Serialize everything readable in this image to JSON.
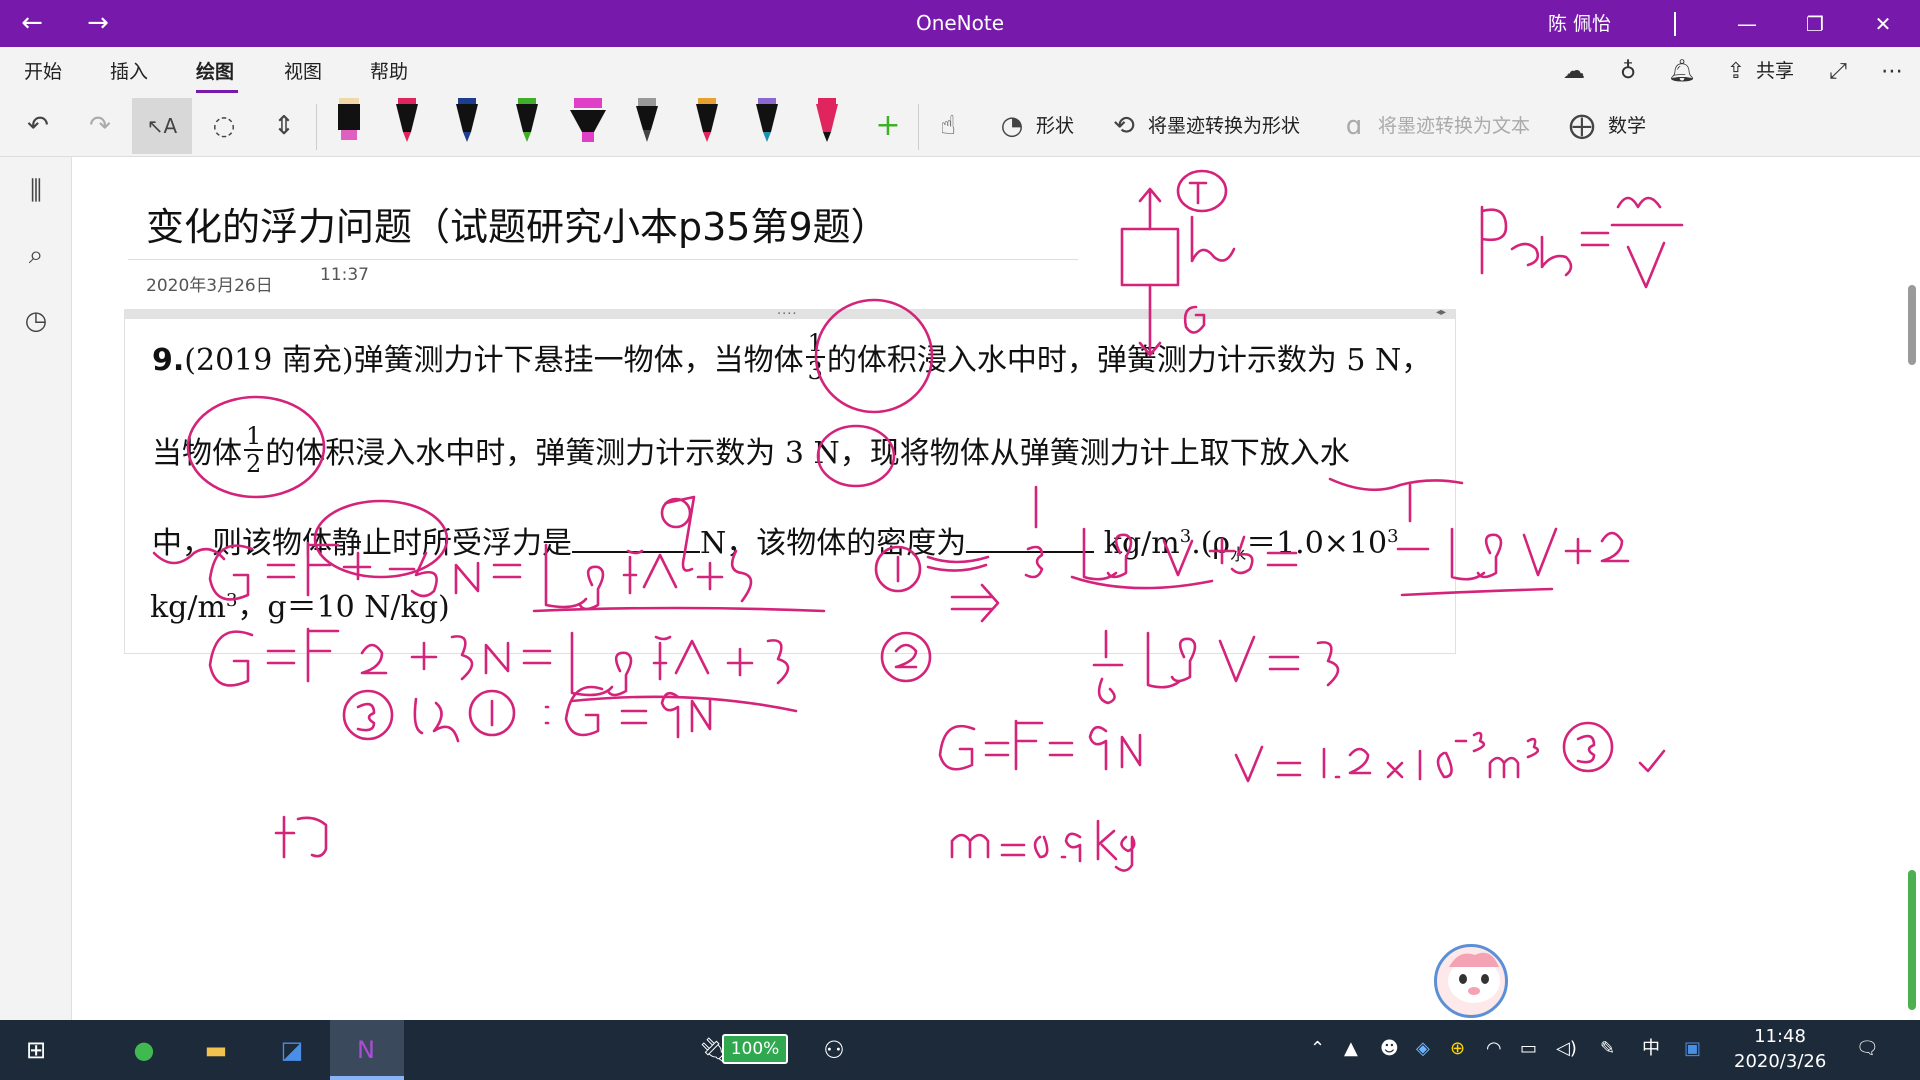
{
  "window": {
    "app_title": "OneNote",
    "user_name": "陈 佩怡",
    "back_icon": "arrow-left-icon",
    "forward_icon": "arrow-right-icon",
    "colors": {
      "titlebar": "#7719aa",
      "ink": "#d4237a"
    }
  },
  "tabs": [
    "开始",
    "插入",
    "绘图",
    "视图",
    "帮助"
  ],
  "active_tab": "绘图",
  "top_actions": {
    "share": "共享"
  },
  "toolbar": {
    "shapes_label": "形状",
    "ink_to_shape_label": "将墨迹转换为形状",
    "ink_to_text_label": "将墨迹转换为文本",
    "math_label": "数学",
    "pens": [
      "#111111",
      "#e0245e",
      "#1d3d8f",
      "#3fae29",
      "#e040c8",
      "#999999",
      "#e0245e",
      "#1d3d8f",
      "#e0245e"
    ]
  },
  "page": {
    "title": "变化的浮力问题（试题研究小本p35第9题）",
    "date": "2020年3月26日",
    "time": "11:37",
    "problem": {
      "number": "9.",
      "line1_a": "(2019 南充)弹簧测力计下悬挂一物体，当物体",
      "frac1_num": "1",
      "frac1_den": "3",
      "line1_b": "的体积浸入水中时，弹簧测力计示数为 5 N，",
      "line2_a": "当物体",
      "frac2_num": "1",
      "frac2_den": "2",
      "line2_b": "的体积浸入水中时，弹簧测力计示数为 3 N，现将物体从弹簧测力计上取下放入水",
      "line3_a": "中，则该物体静止时所受浮力是",
      "line3_b": "N，该物体的密度为",
      "line3_c": " kg/m",
      "line3_d": ".(ρ",
      "line3_e": "水",
      "line3_f": "＝1.0×10",
      "line4_a": "kg/m",
      "line4_b": "，g＝10 N/kg)"
    }
  },
  "taskbar": {
    "battery": "100%",
    "time": "11:48",
    "date": "2020/3/26",
    "ime": "中"
  }
}
